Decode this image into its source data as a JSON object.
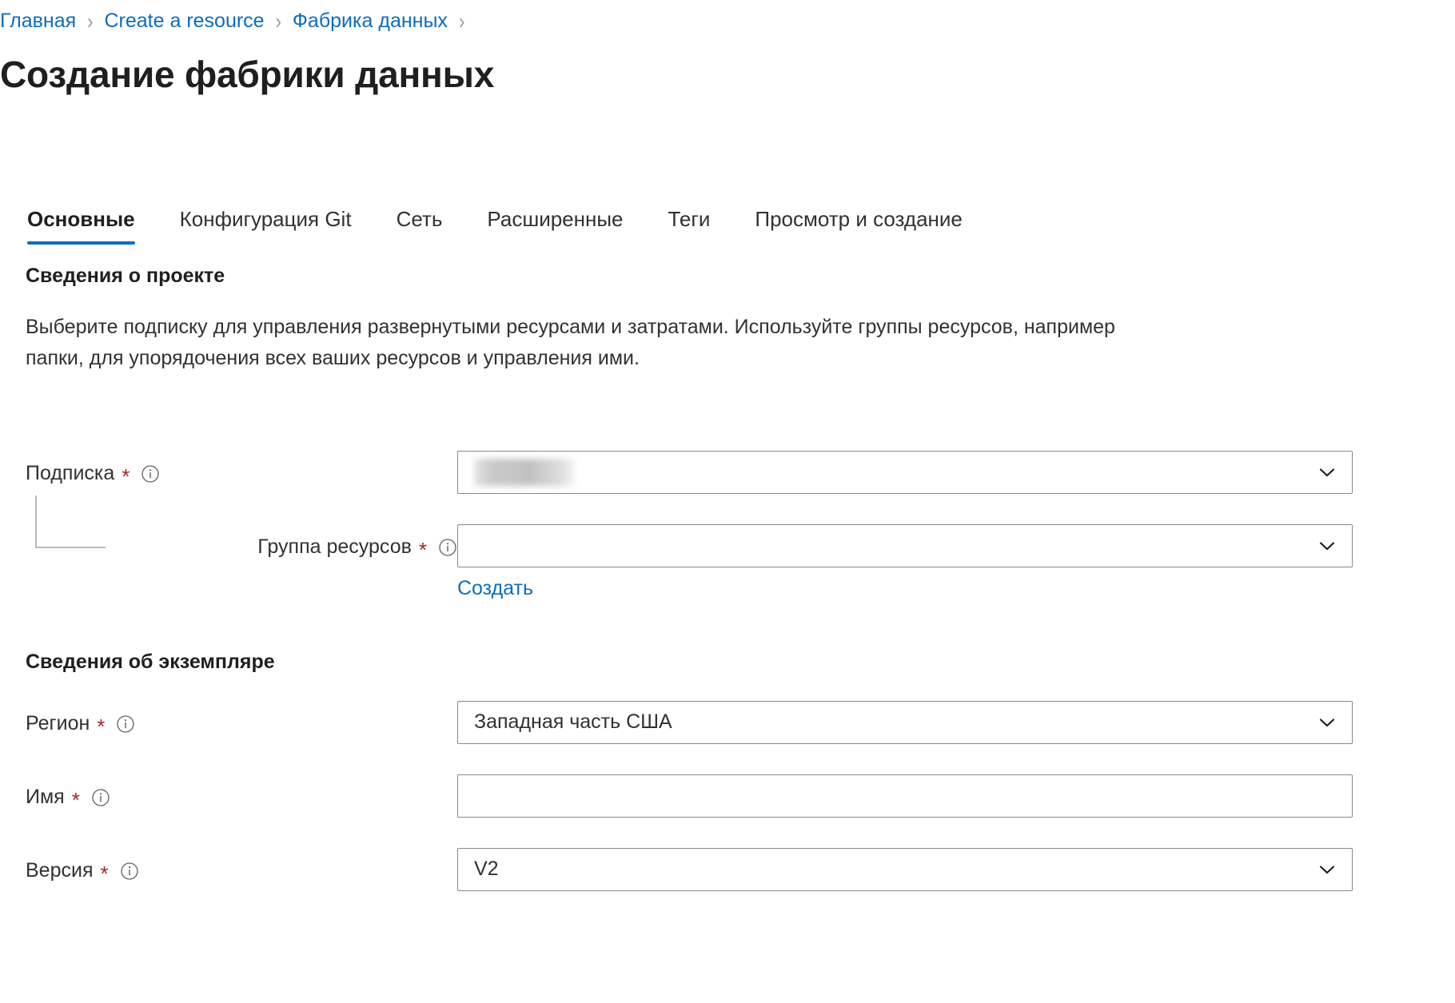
{
  "breadcrumb": {
    "items": [
      {
        "label": "Главная"
      },
      {
        "label": "Create a resource"
      },
      {
        "label": "Фабрика данных"
      }
    ],
    "separator": "›"
  },
  "page": {
    "title": "Создание фабрики данных"
  },
  "tabs": [
    {
      "label": "Основные",
      "active": true
    },
    {
      "label": "Конфигурация Git",
      "active": false
    },
    {
      "label": "Сеть",
      "active": false
    },
    {
      "label": "Расширенные",
      "active": false
    },
    {
      "label": "Теги",
      "active": false
    },
    {
      "label": "Просмотр и создание",
      "active": false
    }
  ],
  "project_details": {
    "heading": "Сведения о проекте",
    "description": "Выберите подписку для управления развернутыми ресурсами и затратами. Используйте группы ресурсов, например папки, для упорядочения всех ваших ресурсов и управления ими.",
    "subscription": {
      "label": "Подписка",
      "required_marker": "*",
      "value": "",
      "value_state": "redacted"
    },
    "resource_group": {
      "label": "Группа ресурсов",
      "required_marker": "*",
      "value": "",
      "create_link": "Создать"
    }
  },
  "instance_details": {
    "heading": "Сведения об экземпляре",
    "region": {
      "label": "Регион",
      "required_marker": "*",
      "value": "Западная часть США"
    },
    "name": {
      "label": "Имя",
      "required_marker": "*",
      "value": "",
      "placeholder": ""
    },
    "version": {
      "label": "Версия",
      "required_marker": "*",
      "value": "V2"
    }
  },
  "icons": {
    "info": "info-icon",
    "chevron_down": "chevron-down-icon"
  },
  "colors": {
    "link": "#0f6cbd",
    "accent_underline": "#0f6cbd",
    "required_star": "#a4262c",
    "border": "#8a8886",
    "text": "#323130"
  }
}
